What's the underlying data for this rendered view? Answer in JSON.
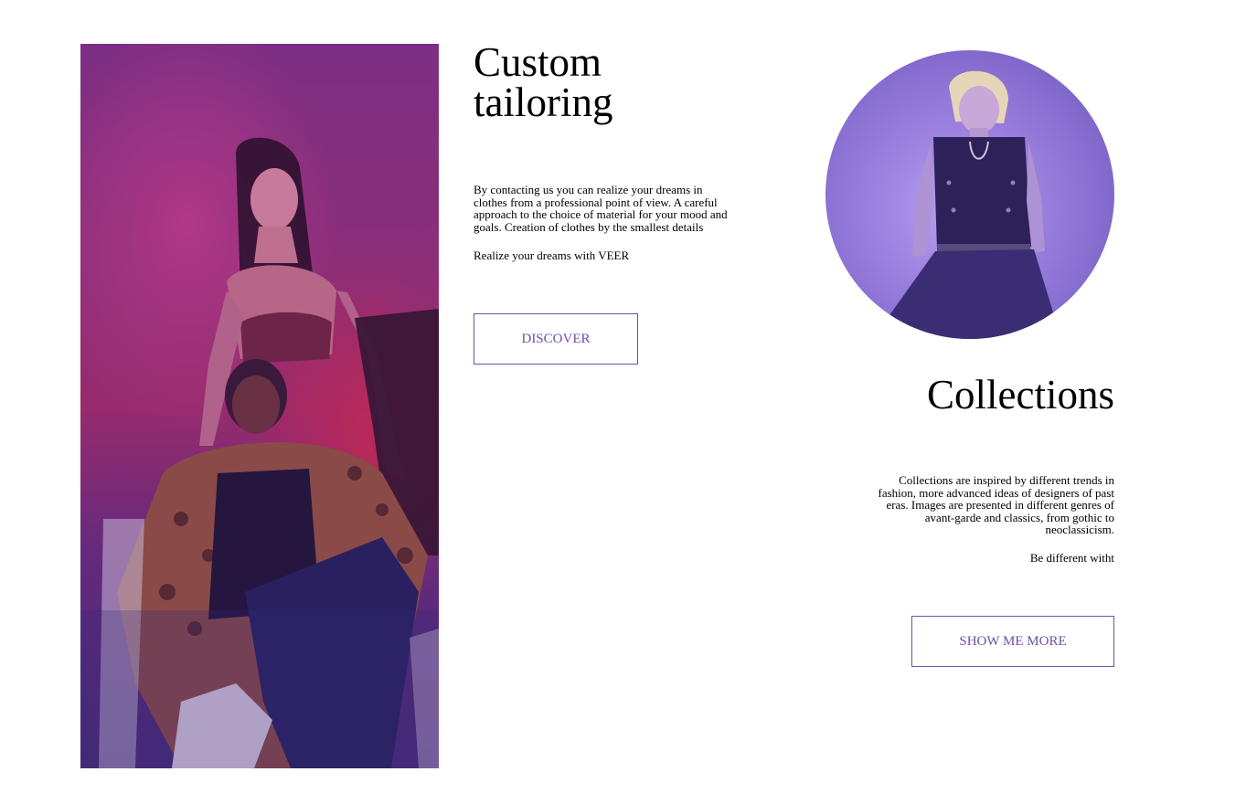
{
  "tailoring": {
    "title": "Custom tailoring",
    "description": "By contacting us you can realize your dreams in clothes from a professional point of view. A careful approach to the choice of material for your mood and goals. Creation of clothes by the smallest details",
    "tagline": "Realize your dreams with VEER",
    "button_label": "DISCOVER"
  },
  "collections": {
    "title": "Collections",
    "description": "Collections are inspired by different trends in fashion, more advanced ideas of designers of past eras. Images are presented in different genres of avant-garde and classics, from gothic to neoclassicism.",
    "tagline": "Be different witht",
    "button_label": "SHOW ME MORE"
  },
  "colors": {
    "accent": "#6f4fa6",
    "background": "#ffffff",
    "text": "#000000",
    "photo_tint_left": "#8c2f78",
    "photo_tint_circle": "#9d82e0"
  }
}
